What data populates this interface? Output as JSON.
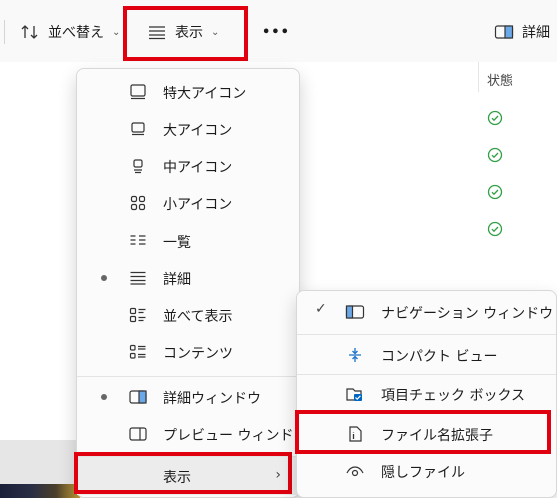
{
  "toolbar": {
    "sort_label": "並べ替え",
    "view_label": "表示",
    "more_label": "•••",
    "details_label": "詳細"
  },
  "content": {
    "status_header": "状態",
    "status_rows": 4
  },
  "view_menu": {
    "items": [
      {
        "label": "特大アイコン"
      },
      {
        "label": "大アイコン"
      },
      {
        "label": "中アイコン"
      },
      {
        "label": "小アイコン"
      },
      {
        "label": "一覧"
      },
      {
        "label": "詳細",
        "selected": true
      },
      {
        "label": "並べて表示"
      },
      {
        "label": "コンテンツ"
      },
      {
        "label": "詳細ウィンドウ",
        "selected": true
      },
      {
        "label": "プレビュー ウィンドウ"
      },
      {
        "label": "表示"
      }
    ]
  },
  "show_submenu": {
    "items": [
      {
        "label": "ナビゲーション ウィンドウ",
        "checked": true,
        "check_mark": "✓"
      },
      {
        "label": "コンパクト ビュー"
      },
      {
        "label": "項目チェック ボックス"
      },
      {
        "label": "ファイル名拡張子"
      },
      {
        "label": "隠しファイル"
      }
    ]
  },
  "colors": {
    "highlight": "#e0000f",
    "status_green": "#2f9e44",
    "checkbox_blue": "#0067c0"
  }
}
